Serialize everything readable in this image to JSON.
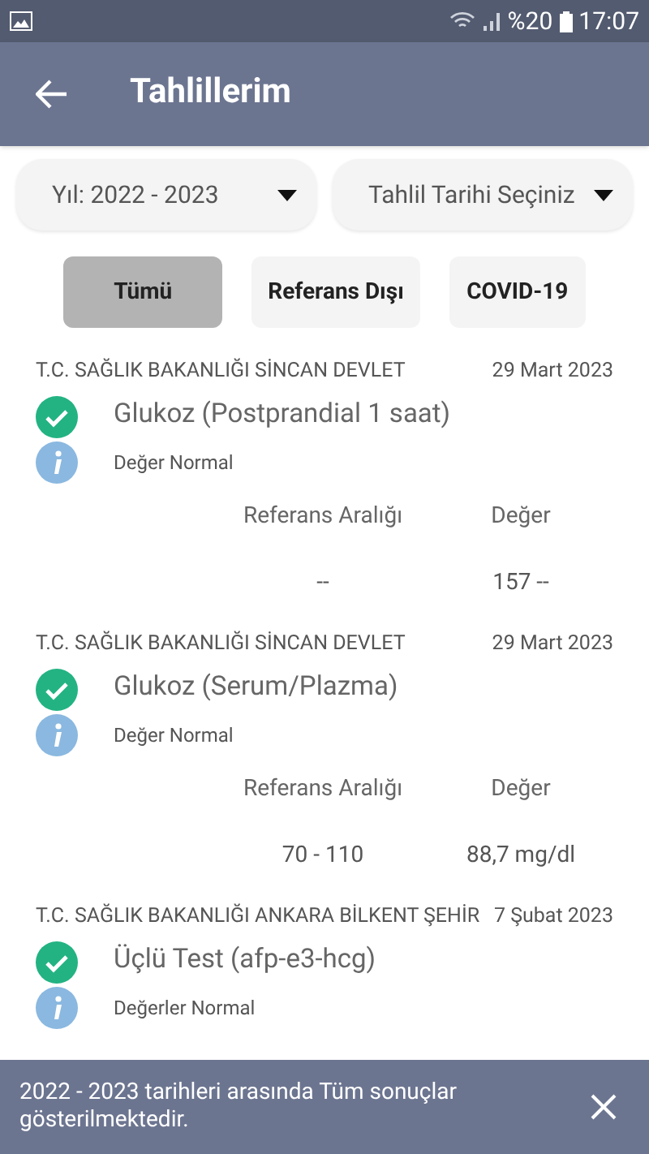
{
  "status_bar": {
    "battery": "%20",
    "time": "17:07"
  },
  "app_bar": {
    "title": "Tahlillerim"
  },
  "filters": [
    {
      "value": "Yıl: 2022 - 2023"
    },
    {
      "value": "Tahlil Tarihi Seçiniz"
    }
  ],
  "tabs": [
    {
      "label": "Tümü",
      "selected": true
    },
    {
      "label": "Referans Dışı",
      "selected": false
    },
    {
      "label": "COVID-19",
      "selected": false
    }
  ],
  "results": [
    {
      "hospital": "T.C. SAĞLIK BAKANLIĞI SİNCAN DEVLET",
      "date": "29 Mart 2023",
      "test": "Glukoz (Postprandial 1 saat)",
      "status": "Değer Normal",
      "columns": [
        {
          "header": "Referans Aralığı",
          "value": "--"
        },
        {
          "header": "Değer",
          "value": "157 --"
        }
      ]
    },
    {
      "hospital": "T.C. SAĞLIK BAKANLIĞI SİNCAN DEVLET",
      "date": "29 Mart 2023",
      "test": "Glukoz (Serum/Plazma)",
      "status": "Değer Normal",
      "columns": [
        {
          "header": "Referans Aralığı",
          "value": "70 - 110"
        },
        {
          "header": "Değer",
          "value": "88,7 mg/dl"
        }
      ]
    },
    {
      "hospital": "T.C. SAĞLIK BAKANLIĞI ANKARA BİLKENT ŞEHİR",
      "date": "7 Şubat 2023",
      "test": "Üçlü Test (afp-e3-hcg)",
      "status": "Değerler Normal"
    }
  ],
  "snackbar": {
    "message": "2022 - 2023 tarihleri arasında Tüm sonuçlar gösterilmektedir."
  }
}
